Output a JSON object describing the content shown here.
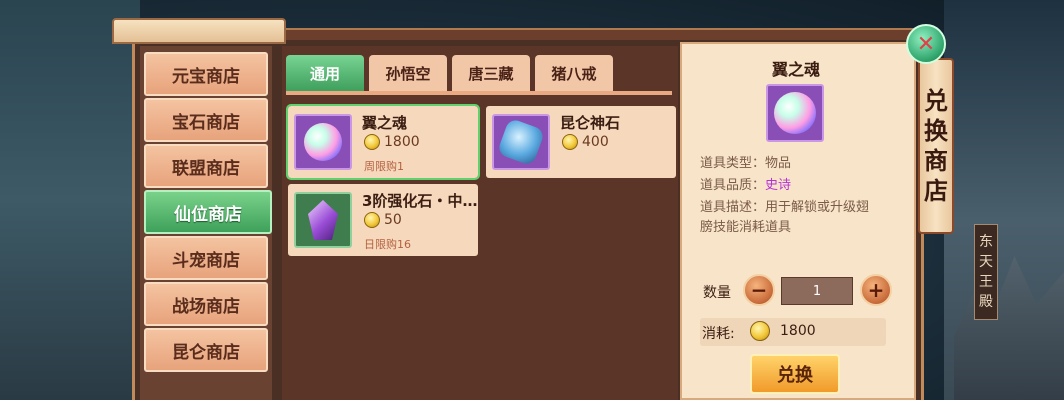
{
  "shop_tabs": [
    "元宝商店",
    "宝石商店",
    "联盟商店",
    "仙位商店",
    "斗宠商店",
    "战场商店",
    "昆仑商店"
  ],
  "active_shop_index": 3,
  "category_tabs": [
    "通用",
    "孙悟空",
    "唐三藏",
    "猪八戒"
  ],
  "active_category_index": 0,
  "items": [
    {
      "name": "翼之魂",
      "price": "1800",
      "limit": "周限购1",
      "icon": "rainbow-orb-icon",
      "selected": true
    },
    {
      "name": "昆仑神石",
      "price": "400",
      "limit": "",
      "icon": "blue-stone-icon",
      "selected": false
    },
    {
      "name": "3阶强化石・中…",
      "price": "50",
      "limit": "日限购16",
      "icon": "purple-crystal-icon",
      "selected": false
    }
  ],
  "detail": {
    "title": "翼之魂",
    "type_label": "道具类型：",
    "type_value": "物品",
    "quality_label": "道具品质：",
    "quality_value": "史诗",
    "desc_label": "道具描述：",
    "desc_value": "用于解锁或升级翅",
    "desc_value2": "膀技能消耗道具",
    "qty_label": "数量",
    "qty_value": "1",
    "minus": "−",
    "plus": "+",
    "cost_label": "消耗:",
    "cost_value": "1800",
    "exchange_label": "兑换"
  },
  "banner_chars": [
    "兑",
    "换",
    "商",
    "店"
  ],
  "location_chars": [
    "东",
    "天",
    "王",
    "殿"
  ],
  "close_symbol": "✕",
  "colors": {
    "epic": "#b432d8",
    "active_tab": "#3ea15a",
    "frame": "#4a2f24"
  }
}
